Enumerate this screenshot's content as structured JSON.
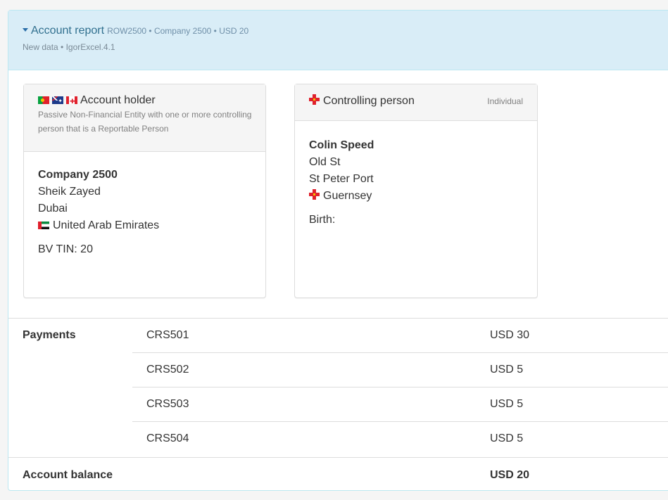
{
  "report": {
    "title": "Account report",
    "subtitle": "ROW2500 • Company 2500 • USD 20",
    "meta": "New data • IgorExcel.4.1"
  },
  "holder": {
    "heading": "Account holder",
    "description": "Passive Non-Financial Entity with one or more controlling person that is a Reportable Person",
    "flags": [
      "portugal-flag-icon",
      "australia-flag-icon",
      "canada-flag-icon"
    ],
    "name": "Company 2500",
    "street": "Sheik Zayed",
    "city": "Dubai",
    "country": "United Arab Emirates",
    "tin": "BV TIN: 20"
  },
  "controller": {
    "heading": "Controlling person",
    "type": "Individual",
    "name": "Colin Speed",
    "street": "Old St",
    "city": "St Peter Port",
    "country": "Guernsey",
    "birth_label": "Birth:"
  },
  "payments": {
    "label": "Payments",
    "rows": [
      {
        "code": "CRS501",
        "amount": "USD 30"
      },
      {
        "code": "CRS502",
        "amount": "USD 5"
      },
      {
        "code": "CRS503",
        "amount": "USD 5"
      },
      {
        "code": "CRS504",
        "amount": "USD 5"
      }
    ]
  },
  "balance": {
    "label": "Account balance",
    "amount": "USD 20"
  },
  "colors": {
    "heading_bg": "#d9edf7",
    "heading_border": "#bce8f1",
    "title": "#31708f",
    "guernsey_red": "#e0202c"
  }
}
